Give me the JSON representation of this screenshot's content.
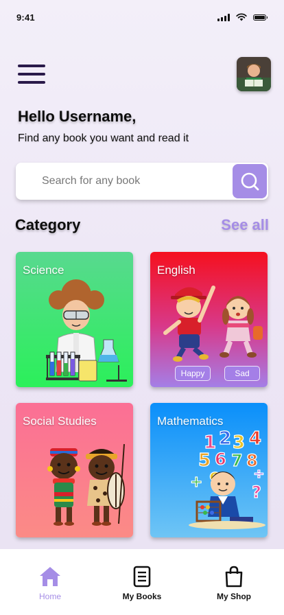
{
  "status_bar": {
    "time": "9:41"
  },
  "header": {
    "greeting": "Hello Username,",
    "subtitle": "Find any book you want and read it"
  },
  "search": {
    "placeholder": "Search for any book"
  },
  "category_section": {
    "title": "Category",
    "see_all_label": "See all",
    "cards": [
      {
        "label": "Science"
      },
      {
        "label": "English",
        "chips": [
          "Happy",
          "Sad"
        ]
      },
      {
        "label": "Social Studies"
      },
      {
        "label": "Mathematics"
      }
    ]
  },
  "bottom_nav": [
    {
      "label": "Home",
      "active": true
    },
    {
      "label": "My Books",
      "active": false
    },
    {
      "label": "My Shop",
      "active": false
    }
  ],
  "colors": {
    "accent": "#a58de6",
    "science": "#2bf05a",
    "english": "#f5101e",
    "social_studies": "#fb6f95",
    "mathematics": "#0a8ffa"
  }
}
